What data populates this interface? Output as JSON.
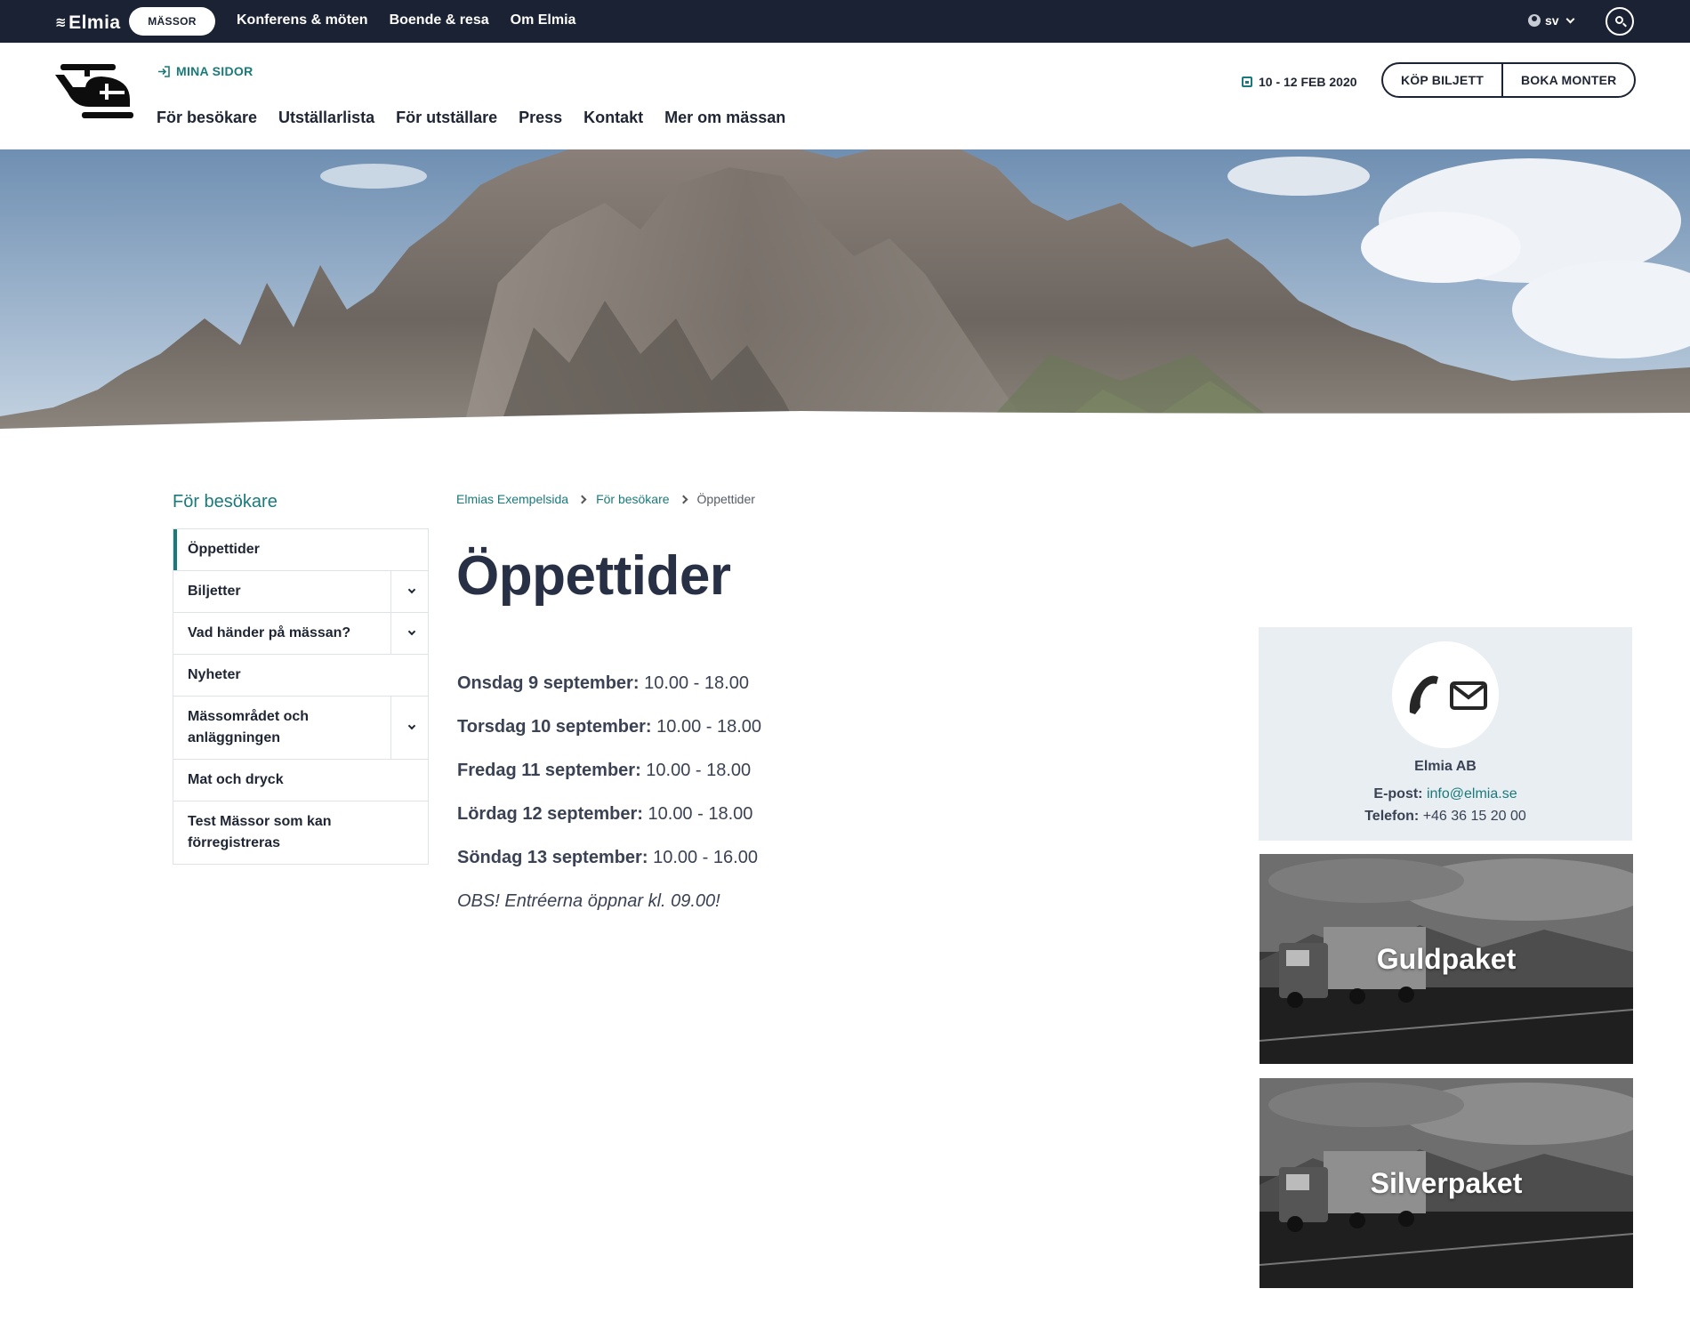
{
  "topbar": {
    "logo": "Elmia",
    "pill": "MÄSSOR",
    "links": [
      "Konferens & möten",
      "Boende & resa",
      "Om Elmia"
    ],
    "lang": "sv"
  },
  "header": {
    "mina_sidor": "MINA SIDOR",
    "nav": [
      "För besökare",
      "Utställarlista",
      "För utställare",
      "Press",
      "Kontakt",
      "Mer om mässan"
    ],
    "date": "10 - 12 FEB 2020",
    "buy_ticket": "KÖP BILJETT",
    "book_booth": "BOKA MONTER"
  },
  "sidebar": {
    "title": "För besökare",
    "items": [
      {
        "label": "Öppettider"
      },
      {
        "label": "Biljetter"
      },
      {
        "label": "Vad händer på mässan?"
      },
      {
        "label": "Nyheter"
      },
      {
        "label": "Mässområdet och anläggningen"
      },
      {
        "label": "Mat och dryck"
      },
      {
        "label": "Test Mässor som kan förregistreras"
      }
    ]
  },
  "breadcrumb": [
    "Elmias Exempelsida",
    "För besökare",
    "Öppettider"
  ],
  "main": {
    "title": "Öppettider",
    "hours": [
      {
        "day": "Onsdag 9 september:",
        "time": " 10.00 - 18.00"
      },
      {
        "day": "Torsdag 10 september:",
        "time": " 10.00 - 18.00"
      },
      {
        "day": "Fredag 11 september:",
        "time": " 10.00 - 18.00"
      },
      {
        "day": "Lördag 12 september:",
        "time": " 10.00 - 18.00"
      },
      {
        "day": "Söndag 13 september:",
        "time": " 10.00 - 16.00"
      }
    ],
    "note": "OBS! Entréerna öppnar kl. 09.00!"
  },
  "contact": {
    "name": "Elmia AB",
    "email_label": "E-post:",
    "email": "info@elmia.se",
    "phone_label": "Telefon:",
    "phone": "+46 36 15 20 00"
  },
  "cards": [
    {
      "label": "Guldpaket"
    },
    {
      "label": "Silverpaket"
    }
  ],
  "colors": {
    "accent": "#1a7a7a",
    "topbar": "#1b2233",
    "contact_bg": "#e9eef3"
  }
}
